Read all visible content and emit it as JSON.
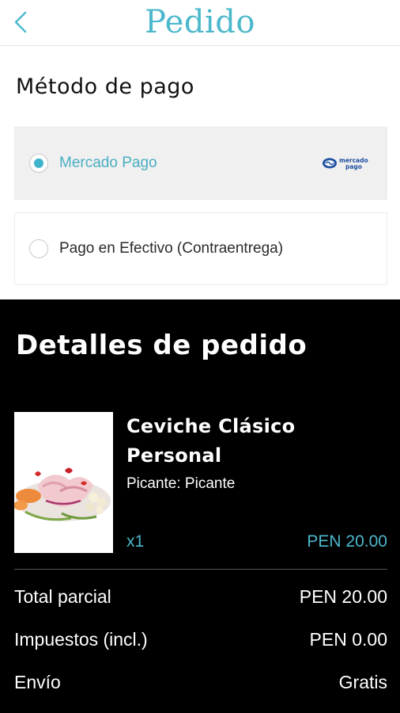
{
  "header": {
    "title": "Pedido",
    "back_icon": "chevron-left-icon"
  },
  "payment": {
    "heading": "Método de pago",
    "options": [
      {
        "label": "Mercado Pago",
        "selected": true,
        "logo_text_1": "mercado",
        "logo_text_2": "pago"
      },
      {
        "label": "Pago en Efectivo (Contraentrega)",
        "selected": false
      }
    ]
  },
  "details": {
    "heading": "Detalles de pedido",
    "item": {
      "name": "Ceviche Clásico Personal",
      "option": "Picante: Picante",
      "quantity": "x1",
      "price": "PEN 20.00"
    },
    "summary": [
      {
        "label": "Total parcial",
        "value": "PEN 20.00"
      },
      {
        "label": "Impuestos (incl.)",
        "value": "PEN 0.00"
      },
      {
        "label": "Envío",
        "value": "Gratis"
      }
    ]
  },
  "colors": {
    "accent": "#4db8cc",
    "selected_bg": "#f0f0f0",
    "dark_bg": "#000000"
  }
}
